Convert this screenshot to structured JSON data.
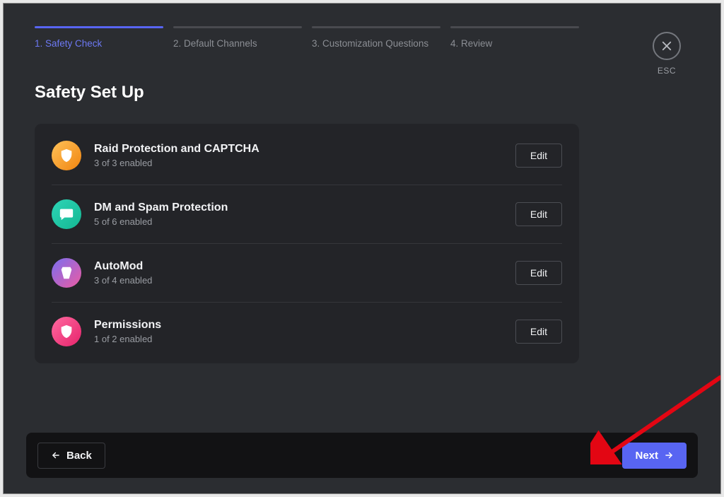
{
  "stepper": {
    "steps": [
      {
        "label": "1. Safety Check",
        "active": true
      },
      {
        "label": "2. Default Channels",
        "active": false
      },
      {
        "label": "3. Customization Questions",
        "active": false
      },
      {
        "label": "4. Review",
        "active": false
      }
    ]
  },
  "close": {
    "label": "ESC"
  },
  "page_title": "Safety Set Up",
  "rows": [
    {
      "title": "Raid Protection and CAPTCHA",
      "sub": "3 of 3 enabled",
      "edit": "Edit",
      "icon": "shield-star-icon",
      "grad": "g-orange"
    },
    {
      "title": "DM and Spam Protection",
      "sub": "5 of 6 enabled",
      "edit": "Edit",
      "icon": "chat-icon",
      "grad": "g-teal"
    },
    {
      "title": "AutoMod",
      "sub": "3 of 4 enabled",
      "edit": "Edit",
      "icon": "automod-icon",
      "grad": "g-violet"
    },
    {
      "title": "Permissions",
      "sub": "1 of 2 enabled",
      "edit": "Edit",
      "icon": "shield-user-icon",
      "grad": "g-pink"
    }
  ],
  "footer": {
    "back": "Back",
    "next": "Next"
  },
  "colors": {
    "accent": "#5865f2",
    "bg": "#2b2d31",
    "panel": "#232428",
    "footer": "#121214"
  }
}
